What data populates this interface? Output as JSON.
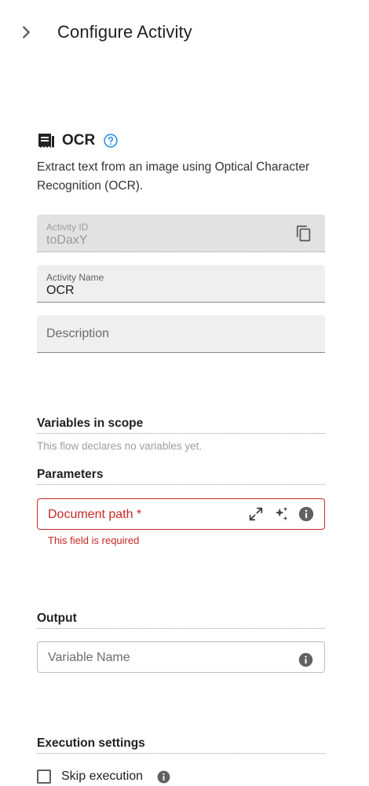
{
  "header": {
    "title": "Configure Activity",
    "back_icon": "chevron-right-icon"
  },
  "activity": {
    "name": "OCR",
    "icon": "receipt-icon",
    "help_icon": "help-circle-icon",
    "description": "Extract text from an image using Optical Character Recognition (OCR)."
  },
  "fields": {
    "activity_id": {
      "label": "Activity ID",
      "value": "toDaxY",
      "icon": "copy-icon"
    },
    "activity_name": {
      "label": "Activity Name",
      "value": "OCR"
    },
    "description": {
      "placeholder": "Description"
    }
  },
  "variables": {
    "title": "Variables in scope",
    "empty_text": "This flow declares no variables yet."
  },
  "parameters": {
    "title": "Parameters",
    "document_path": {
      "placeholder": "Document path *",
      "error": "This field is required",
      "icons": [
        "expand-icon",
        "sparkle-icon",
        "info-icon"
      ]
    }
  },
  "output": {
    "title": "Output",
    "variable_name": {
      "placeholder": "Variable Name",
      "icon": "info-icon"
    }
  },
  "execution": {
    "title": "Execution settings",
    "skip": {
      "label": "Skip execution",
      "checked": false,
      "icon": "info-icon"
    }
  },
  "colors": {
    "error": "#c62828",
    "help": "#1e88e5",
    "field_bg": "#efefef",
    "disabled_bg": "#e2e2e2"
  }
}
